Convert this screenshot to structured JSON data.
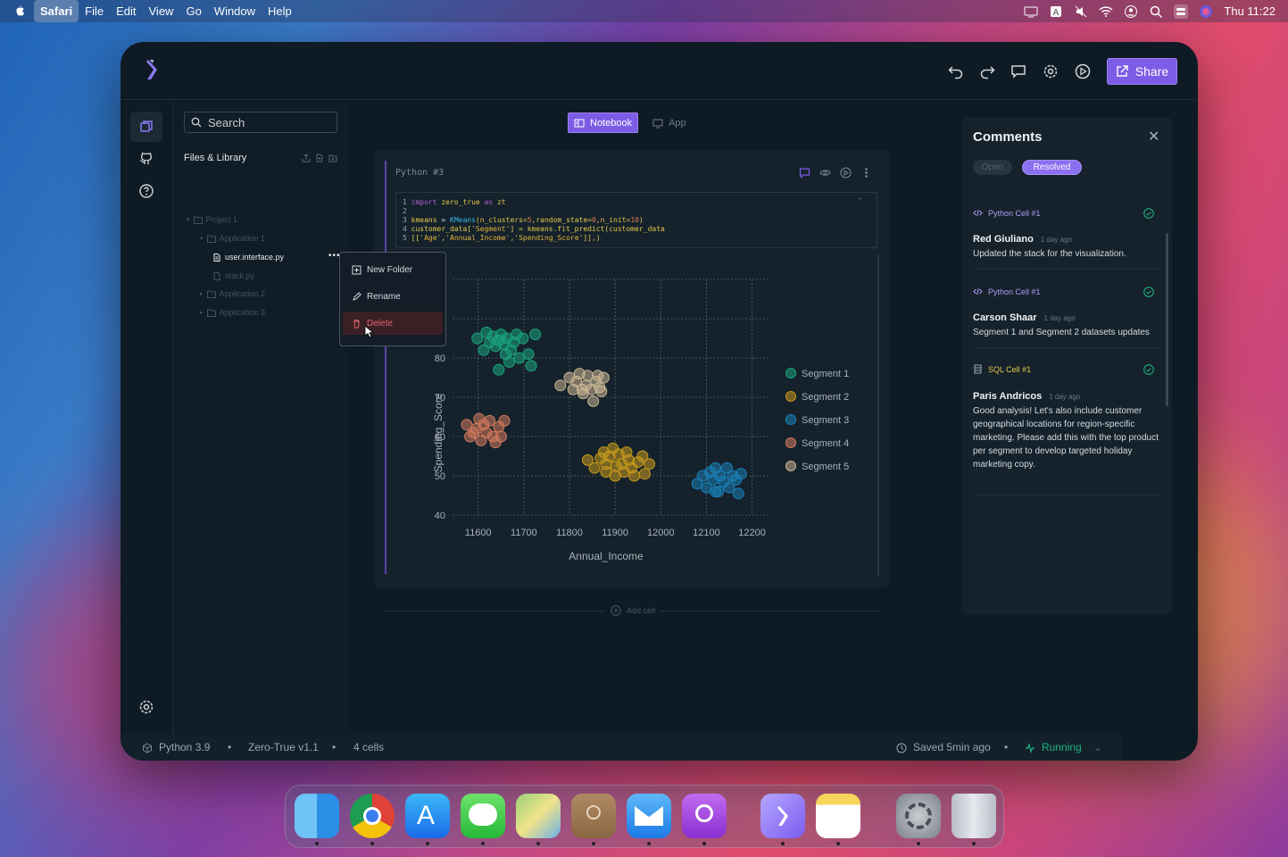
{
  "menubar": {
    "app": "Safari",
    "items": [
      "File",
      "Edit",
      "View",
      "Go",
      "Window",
      "Help"
    ],
    "clock": "Thu 11:22"
  },
  "toolbar": {
    "share_label": "Share"
  },
  "files": {
    "search_placeholder": "Search",
    "header": "Files & Library",
    "tree": [
      {
        "label": "Project 1"
      },
      {
        "label": "Application 1"
      },
      {
        "label": "user.interface.py"
      },
      {
        "label": "stack.py"
      },
      {
        "label": "Application 2"
      },
      {
        "label": "Application 3"
      }
    ]
  },
  "context_menu": {
    "new_folder": "New Folder",
    "rename": "Rename",
    "delete": "Delete"
  },
  "view_tabs": {
    "notebook": "Notebook",
    "app": "App"
  },
  "cell": {
    "title": "Python #3",
    "code": [
      {
        "n": "1",
        "parts": [
          [
            "kw",
            "import "
          ],
          [
            "yl",
            "zero_true "
          ],
          [
            "kw",
            "as "
          ],
          [
            "yl",
            "zt"
          ]
        ]
      },
      {
        "n": "2",
        "parts": []
      },
      {
        "n": "3",
        "parts": [
          [
            "yl",
            "kmeans "
          ],
          [
            "",
            "= "
          ],
          [
            "fn",
            "KMeans"
          ],
          [
            "yl",
            "(n_clusters="
          ],
          [
            "nm",
            "5"
          ],
          [
            "yl",
            ",random_state="
          ],
          [
            "nm",
            "0"
          ],
          [
            "yl",
            ",n_init="
          ],
          [
            "nm",
            "10"
          ],
          [
            "yl",
            ")"
          ]
        ]
      },
      {
        "n": "4",
        "parts": [
          [
            "yl",
            "customer_data["
          ],
          [
            "st",
            "'Segment'"
          ],
          [
            "yl",
            "] = kmeans.fit_predict(customer_data"
          ]
        ]
      },
      {
        "n": "5",
        "parts": [
          [
            "yl",
            "[["
          ],
          [
            "st",
            "'Age'"
          ],
          [
            "yl",
            ","
          ],
          [
            "st",
            "'Annual_Income'"
          ],
          [
            "yl",
            ","
          ],
          [
            "st",
            "'Spending_Score'"
          ],
          [
            "yl",
            "]],)"
          ]
        ]
      }
    ]
  },
  "add_cell": "Add cell",
  "chart_data": {
    "type": "scatter",
    "xlabel": "Annual_Income",
    "ylabel": "Spending_Score",
    "xlim": [
      11575,
      12240
    ],
    "ylim": [
      40,
      100
    ],
    "xticks": [
      11600,
      11700,
      11800,
      11900,
      12000,
      12100,
      12200
    ],
    "yticks": [
      40,
      50,
      60,
      70,
      80,
      90,
      100
    ],
    "grid": true,
    "legend_position": "right",
    "series": [
      {
        "name": "Segment 1",
        "color": "#1aa37f",
        "points": [
          [
            11598,
            85
          ],
          [
            11612,
            82
          ],
          [
            11618,
            86.5
          ],
          [
            11625,
            84
          ],
          [
            11632,
            85.5
          ],
          [
            11638,
            83
          ],
          [
            11645,
            84.5
          ],
          [
            11650,
            86
          ],
          [
            11656,
            83.5
          ],
          [
            11660,
            81
          ],
          [
            11663,
            85
          ],
          [
            11668,
            79
          ],
          [
            11672,
            82
          ],
          [
            11678,
            84
          ],
          [
            11684,
            86
          ],
          [
            11690,
            80
          ],
          [
            11698,
            85
          ],
          [
            11710,
            81
          ],
          [
            11716,
            78
          ],
          [
            11725,
            86
          ],
          [
            11645,
            77
          ]
        ]
      },
      {
        "name": "Segment 2",
        "color": "#c99a1c",
        "points": [
          [
            11840,
            54
          ],
          [
            11855,
            52
          ],
          [
            11868,
            54.5
          ],
          [
            11875,
            56
          ],
          [
            11880,
            53
          ],
          [
            11888,
            55
          ],
          [
            11895,
            57
          ],
          [
            11902,
            52.5
          ],
          [
            11908,
            55.5
          ],
          [
            11915,
            53
          ],
          [
            11920,
            51
          ],
          [
            11925,
            56
          ],
          [
            11930,
            54
          ],
          [
            11936,
            52
          ],
          [
            11942,
            50
          ],
          [
            11950,
            53.5
          ],
          [
            11960,
            55
          ],
          [
            11965,
            50.5
          ],
          [
            11975,
            53
          ],
          [
            11880,
            51
          ],
          [
            11900,
            50
          ]
        ]
      },
      {
        "name": "Segment 3",
        "color": "#1a7fb7",
        "points": [
          [
            12080,
            48
          ],
          [
            12092,
            50
          ],
          [
            12100,
            47
          ],
          [
            12108,
            51
          ],
          [
            12115,
            49
          ],
          [
            12120,
            52
          ],
          [
            12126,
            46
          ],
          [
            12130,
            50
          ],
          [
            12138,
            48.5
          ],
          [
            12145,
            52
          ],
          [
            12150,
            47
          ],
          [
            12158,
            50
          ],
          [
            12165,
            49
          ],
          [
            12170,
            45.5
          ],
          [
            12176,
            50.5
          ],
          [
            12120,
            46
          ]
        ]
      },
      {
        "name": "Segment 4",
        "color": "#d47a5c",
        "points": [
          [
            11575,
            63
          ],
          [
            11582,
            60
          ],
          [
            11590,
            61
          ],
          [
            11596,
            62
          ],
          [
            11602,
            64.5
          ],
          [
            11606,
            59
          ],
          [
            11612,
            63
          ],
          [
            11618,
            61
          ],
          [
            11625,
            64
          ],
          [
            11632,
            60
          ],
          [
            11638,
            58.5
          ],
          [
            11645,
            62.5
          ],
          [
            11650,
            60
          ],
          [
            11657,
            64
          ]
        ]
      },
      {
        "name": "Segment 5",
        "color": "#c8b594",
        "points": [
          [
            11780,
            73
          ],
          [
            11800,
            75
          ],
          [
            11808,
            72
          ],
          [
            11815,
            74
          ],
          [
            11822,
            76
          ],
          [
            11830,
            71
          ],
          [
            11836,
            73
          ],
          [
            11840,
            75.5
          ],
          [
            11848,
            72
          ],
          [
            11852,
            69
          ],
          [
            11858,
            74
          ],
          [
            11862,
            75.5
          ],
          [
            11866,
            72.5
          ],
          [
            11870,
            71.5
          ],
          [
            11875,
            75
          ],
          [
            11828,
            72
          ]
        ]
      }
    ]
  },
  "comments": {
    "title": "Comments",
    "tab_open": "Open",
    "tab_resolved": "Resolved",
    "items": [
      {
        "tag": "Python Cell #1",
        "name": "Red Giuliano",
        "time": "1 day ago",
        "text": "Updated the stack for the visualization."
      },
      {
        "tag": "Python Cell #1",
        "name": "Carson Shaar",
        "time": "1 day ago",
        "text": "Segment 1 and Segment 2 datasets updates"
      },
      {
        "tag": "SQL Cell #1",
        "name": "Paris Andricos",
        "time": "1 day ago",
        "text": "Good analysis! Let's also include customer geographical locations for region-specific marketing. Please add this with the top product per segment to develop targeted holiday marketing copy."
      }
    ]
  },
  "status": {
    "python": "Python 3.9",
    "version": "Zero-True v1.1",
    "cells": "4 cells",
    "saved": "Saved 5min ago",
    "state": "Running"
  },
  "dock": [
    "finder-icon",
    "chrome-icon",
    "app-store-icon",
    "messages-icon",
    "maps-icon",
    "contacts-icon",
    "mail-icon",
    "podcasts-icon",
    "zero-true-icon",
    "notes-icon",
    "system-settings-icon",
    "trash-icon"
  ]
}
